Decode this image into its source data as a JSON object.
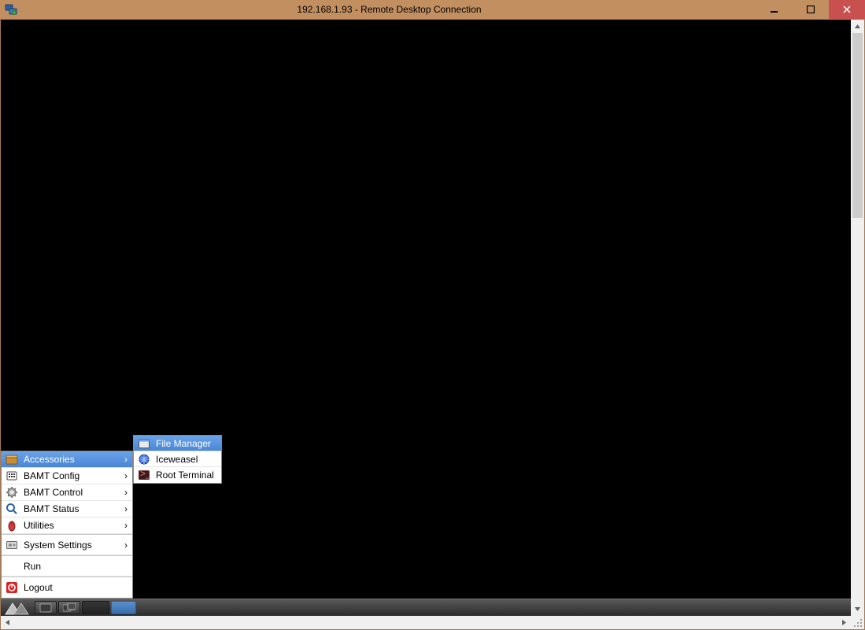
{
  "window": {
    "title": "192.168.1.93 - Remote Desktop Connection"
  },
  "menu": {
    "items": [
      {
        "label": "Accessories",
        "icon": "apps-icon",
        "submenu": true,
        "hover": true
      },
      {
        "label": "BAMT Config",
        "icon": "config-icon",
        "submenu": true
      },
      {
        "label": "BAMT Control",
        "icon": "gear-icon",
        "submenu": true
      },
      {
        "label": "BAMT Status",
        "icon": "magnifier-icon",
        "submenu": true
      },
      {
        "label": "Utilities",
        "icon": "mouse-icon",
        "submenu": true
      },
      {
        "label": "System Settings",
        "icon": "settings-icon",
        "submenu": true,
        "sep": true,
        "class": "settings-row"
      },
      {
        "label": "Run",
        "icon": "",
        "submenu": false,
        "sep": true,
        "class": "run-row"
      },
      {
        "label": "Logout",
        "icon": "power-icon",
        "submenu": false,
        "sep": true,
        "class": "logout-row"
      }
    ]
  },
  "submenu": {
    "items": [
      {
        "label": "File Manager",
        "icon": "filemgr-icon",
        "hover": true
      },
      {
        "label": "Iceweasel",
        "icon": "globe-icon"
      },
      {
        "label": "Root Terminal",
        "icon": "terminal-icon"
      }
    ]
  }
}
